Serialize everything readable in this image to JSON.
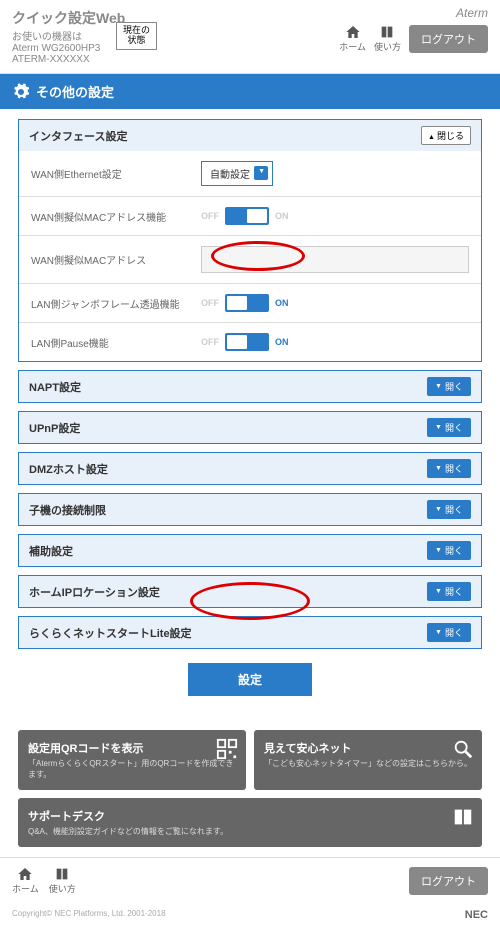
{
  "header": {
    "title": "クイック設定Web",
    "sub1": "お使いの機器は",
    "sub2": "Aterm WG2600HP3",
    "sub3": "ATERM-XXXXXX",
    "brand": "Aterm",
    "status_btn": "現在の\n状態",
    "home": "ホーム",
    "guide": "使い方",
    "logout": "ログアウト"
  },
  "section": {
    "title": "その他の設定"
  },
  "interface": {
    "title": "インタフェース設定",
    "close": "閉じる",
    "rows": {
      "wan_eth": {
        "label": "WAN側Ethernet設定",
        "value": "自動設定"
      },
      "wan_mac_func": {
        "label": "WAN側擬似MACアドレス機能",
        "off": "OFF",
        "on": "ON"
      },
      "wan_mac_addr": {
        "label": "WAN側擬似MACアドレス",
        "value": ""
      },
      "lan_jumbo": {
        "label": "LAN側ジャンボフレーム透過機能",
        "off": "OFF",
        "on": "ON"
      },
      "lan_pause": {
        "label": "LAN側Pause機能",
        "off": "OFF",
        "on": "ON"
      }
    }
  },
  "panels": [
    "NAPT設定",
    "UPnP設定",
    "DMZホスト設定",
    "子機の接続制限",
    "補助設定",
    "ホームIPロケーション設定",
    "らくらくネットスタートLite設定"
  ],
  "open_label": "開く",
  "apply": "設定",
  "footer": {
    "qr": {
      "title": "設定用QRコードを表示",
      "sub": "「AtermらくらくQRスタート」用のQRコードを作成できます。"
    },
    "safe": {
      "title": "見えて安心ネット",
      "sub": "「こども安心ネットタイマー」などの設定はこちらから。"
    },
    "support": {
      "title": "サポートデスク",
      "sub": "Q&A、機能別設定ガイドなどの情報をご覧になれます。"
    }
  },
  "copy": "Copyright© NEC Platforms, Ltd. 2001-2018",
  "nec": "NEC"
}
